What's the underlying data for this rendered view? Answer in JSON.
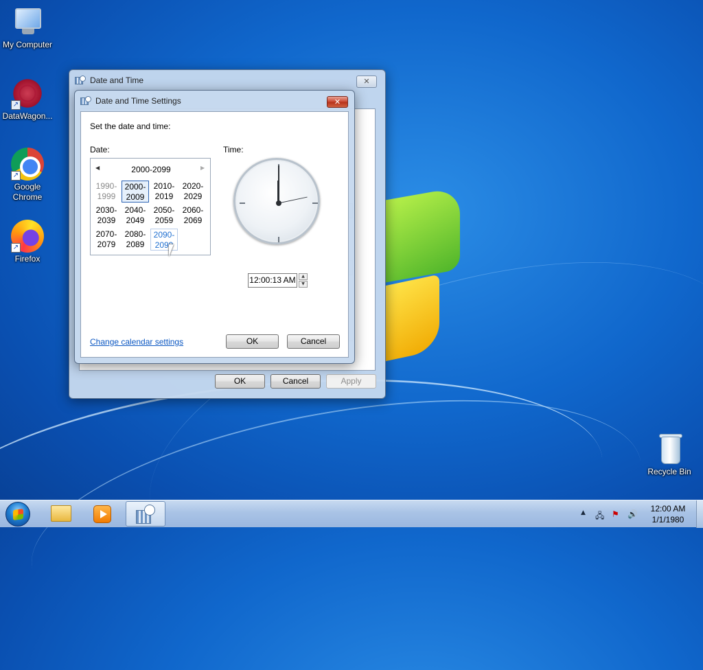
{
  "desktop": {
    "icons": [
      {
        "label": "My Computer",
        "icon": "computer-icon"
      },
      {
        "label": "DataWagon...",
        "icon": "datawagon-icon"
      },
      {
        "label": "Google Chrome",
        "icon": "chrome-icon"
      },
      {
        "label": "Firefox",
        "icon": "firefox-icon"
      },
      {
        "label": "Recycle Bin",
        "icon": "recycle-bin-icon"
      }
    ]
  },
  "outer_dialog": {
    "title": "Date and Time",
    "close_glyph": "✕",
    "buttons": {
      "ok": "OK",
      "cancel": "Cancel",
      "apply": "Apply"
    }
  },
  "settings_dialog": {
    "title": "Date and Time Settings",
    "close_glyph": "✕",
    "instruction": "Set the date and time:",
    "date_label": "Date:",
    "time_label": "Time:",
    "calendar": {
      "prev_glyph": "◀",
      "next_glyph": "▶",
      "range": "2000-2099",
      "decades": [
        {
          "top": "1990-",
          "bottom": "1999"
        },
        {
          "top": "2000-",
          "bottom": "2009"
        },
        {
          "top": "2010-",
          "bottom": "2019"
        },
        {
          "top": "2020-",
          "bottom": "2029"
        },
        {
          "top": "2030-",
          "bottom": "2039"
        },
        {
          "top": "2040-",
          "bottom": "2049"
        },
        {
          "top": "2050-",
          "bottom": "2059"
        },
        {
          "top": "2060-",
          "bottom": "2069"
        },
        {
          "top": "2070-",
          "bottom": "2079"
        },
        {
          "top": "2080-",
          "bottom": "2089"
        },
        {
          "top": "2090-",
          "bottom": "2099"
        }
      ],
      "selected": "2000-2009",
      "hovered": "2090-2099"
    },
    "time_value": "12:00:13 AM",
    "spin_up": "▲",
    "spin_down": "▼",
    "change_calendar_link": "Change calendar settings",
    "buttons": {
      "ok": "OK",
      "cancel": "Cancel"
    }
  },
  "taskbar": {
    "apps": [
      "windows-explorer-icon",
      "media-player-icon",
      "date-time-icon"
    ],
    "tray": {
      "arrow": "▲",
      "time": "12:00 AM",
      "date": "1/1/1980"
    }
  },
  "colors": {
    "link": "#0b57c2",
    "close_red": "#c9452f",
    "selection": "#2d64b4"
  }
}
